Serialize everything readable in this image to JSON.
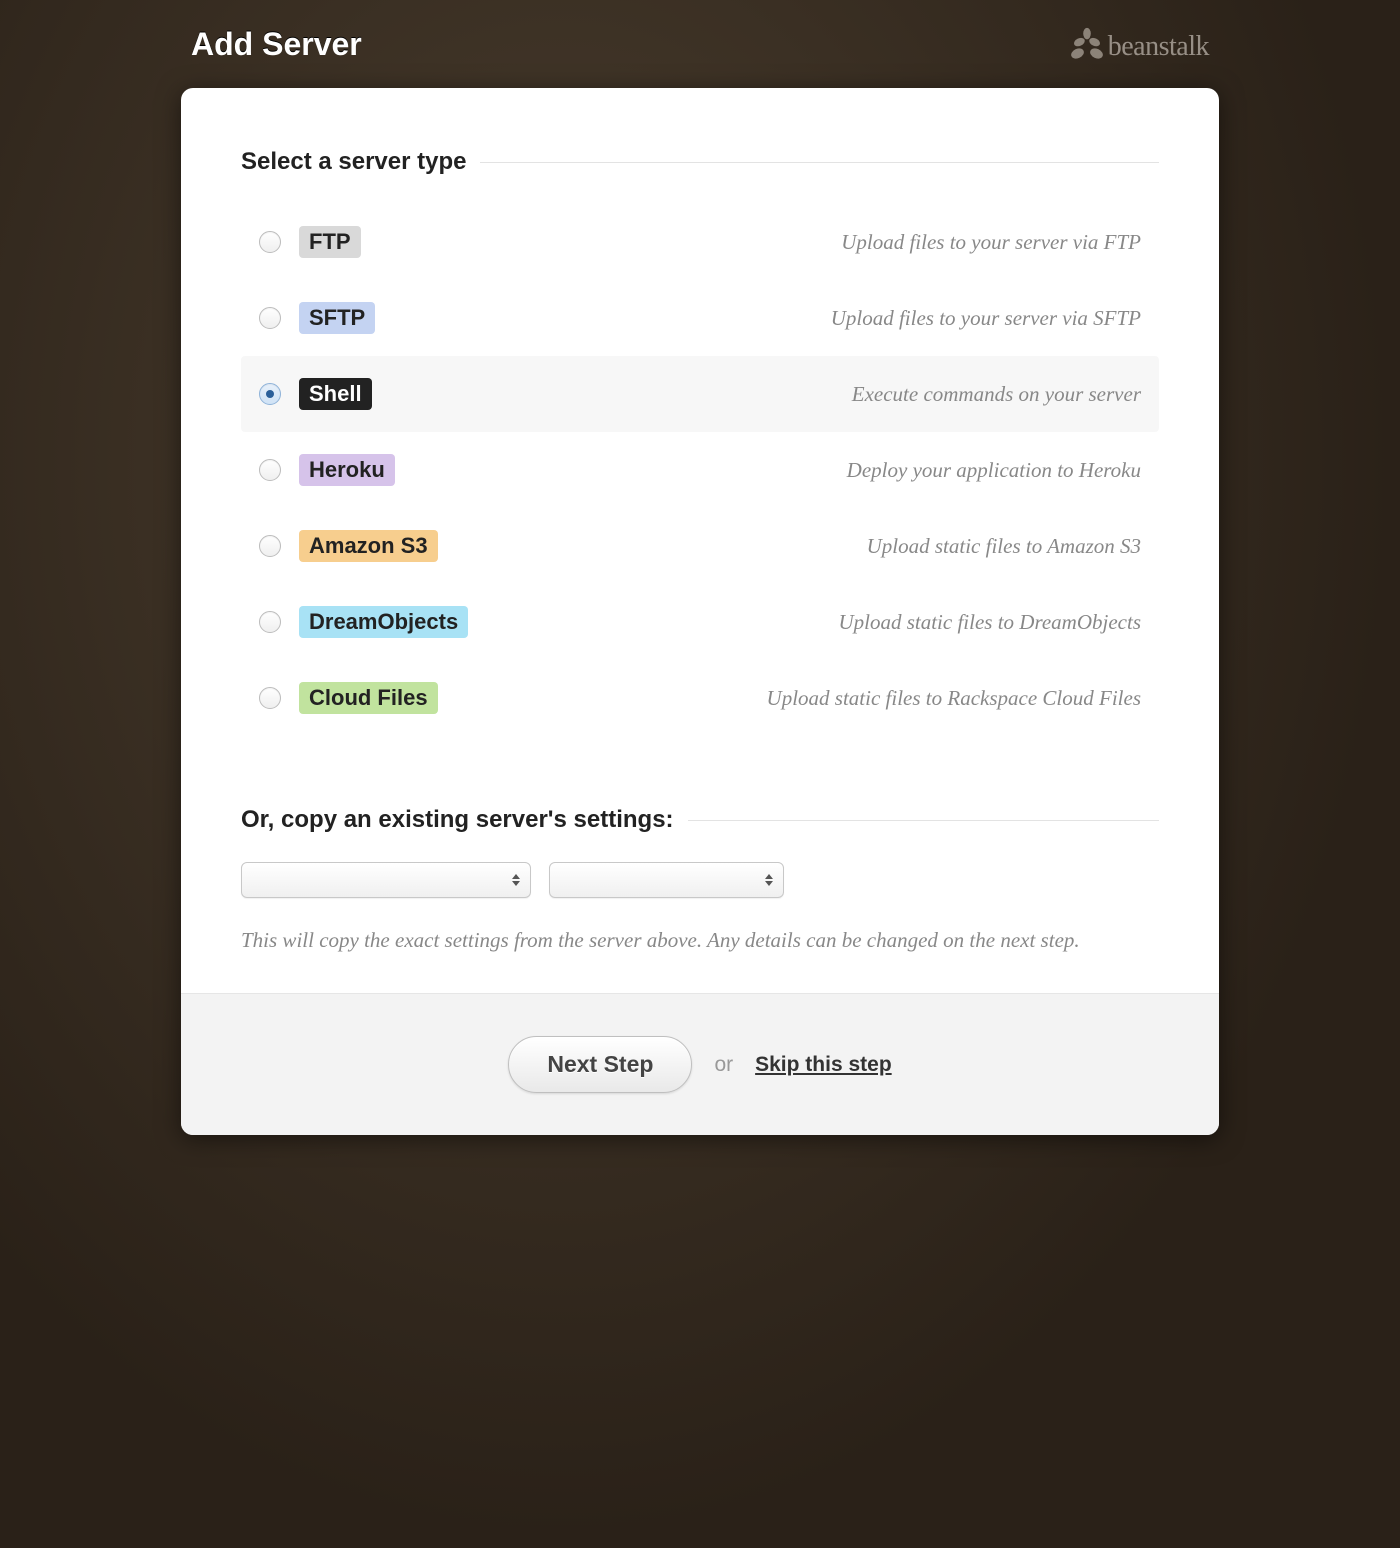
{
  "header": {
    "title": "Add Server",
    "logo_text": "beanstalk"
  },
  "section": {
    "title": "Select a server type"
  },
  "options": [
    {
      "key": "ftp",
      "label": "FTP",
      "desc": "Upload files to your server via FTP",
      "selected": false,
      "badge_class": "badge-ftp"
    },
    {
      "key": "sftp",
      "label": "SFTP",
      "desc": "Upload files to your server via SFTP",
      "selected": false,
      "badge_class": "badge-sftp"
    },
    {
      "key": "shell",
      "label": "Shell",
      "desc": "Execute commands on your server",
      "selected": true,
      "badge_class": "badge-shell"
    },
    {
      "key": "heroku",
      "label": "Heroku",
      "desc": "Deploy your application to Heroku",
      "selected": false,
      "badge_class": "badge-heroku"
    },
    {
      "key": "s3",
      "label": "Amazon S3",
      "desc": "Upload static files to Amazon S3",
      "selected": false,
      "badge_class": "badge-s3"
    },
    {
      "key": "dreamobjects",
      "label": "DreamObjects",
      "desc": "Upload static files to DreamObjects",
      "selected": false,
      "badge_class": "badge-dream"
    },
    {
      "key": "cloudfiles",
      "label": "Cloud Files",
      "desc": "Upload static files to Rackspace Cloud Files",
      "selected": false,
      "badge_class": "badge-cloud"
    }
  ],
  "copy": {
    "title": "Or, copy an existing server's settings:",
    "dropdown1": "",
    "dropdown2": "",
    "help": "This will copy the exact settings from the server above. Any details can be changed on the next step."
  },
  "footer": {
    "next": "Next Step",
    "or": "or",
    "skip": "Skip this step"
  }
}
